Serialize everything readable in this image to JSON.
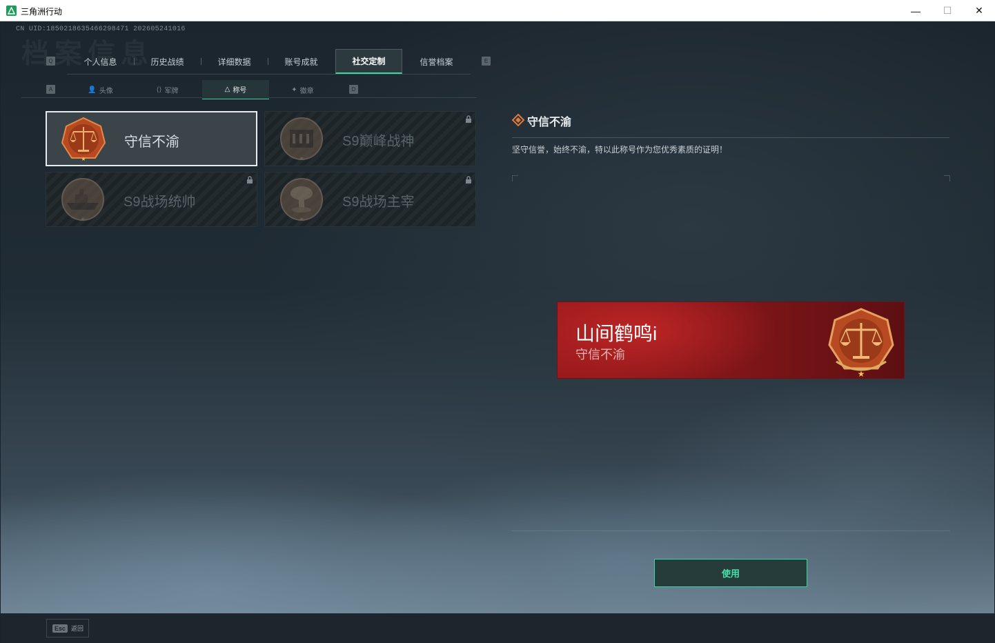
{
  "window": {
    "title": "三角洲行动",
    "min_glyph": "—",
    "max_glyph": "☐",
    "close_glyph": "✕"
  },
  "header": {
    "uid": "CN UID:1850218635466298471 202605241016",
    "watermark": "档案信息"
  },
  "keys": {
    "q": "Q",
    "e": "E",
    "a": "A",
    "d": "D"
  },
  "main_tabs": [
    {
      "label": "个人信息",
      "active": false
    },
    {
      "label": "历史战绩",
      "active": false
    },
    {
      "label": "详细数据",
      "active": false
    },
    {
      "label": "账号成就",
      "active": false
    },
    {
      "label": "社交定制",
      "active": true
    },
    {
      "label": "信誉档案",
      "active": false
    }
  ],
  "sub_tabs": [
    {
      "label": "头像",
      "icon": "person-icon",
      "active": false
    },
    {
      "label": "军牌",
      "icon": "dogtag-icon",
      "active": false
    },
    {
      "label": "称号",
      "icon": "triangle-icon",
      "active": true
    },
    {
      "label": "徽章",
      "icon": "badge-icon",
      "active": false
    }
  ],
  "titles": [
    {
      "name": "守信不渝",
      "locked": false,
      "selected": true,
      "icon": "scales-icon"
    },
    {
      "name": "S9巅峰战神",
      "locked": true,
      "selected": false,
      "icon": "fortress-icon"
    },
    {
      "name": "S9战场统帅",
      "locked": true,
      "selected": false,
      "icon": "warship-icon"
    },
    {
      "name": "S9战场主宰",
      "locked": true,
      "selected": false,
      "icon": "mushroom-cloud-icon"
    }
  ],
  "detail": {
    "title": "守信不渝",
    "description": "坚守信誉，始终不渝，特以此称号作为您优秀素质的证明！"
  },
  "preview": {
    "player_name": "山间鹤鸣i",
    "title": "守信不渝"
  },
  "actions": {
    "use_label": "使用",
    "esc_key": "Esc",
    "back_label": "返回"
  },
  "colors": {
    "accent": "#3dd6a2",
    "banner_red": "#8c1a1c",
    "medal_bronze": "#c2562a"
  }
}
